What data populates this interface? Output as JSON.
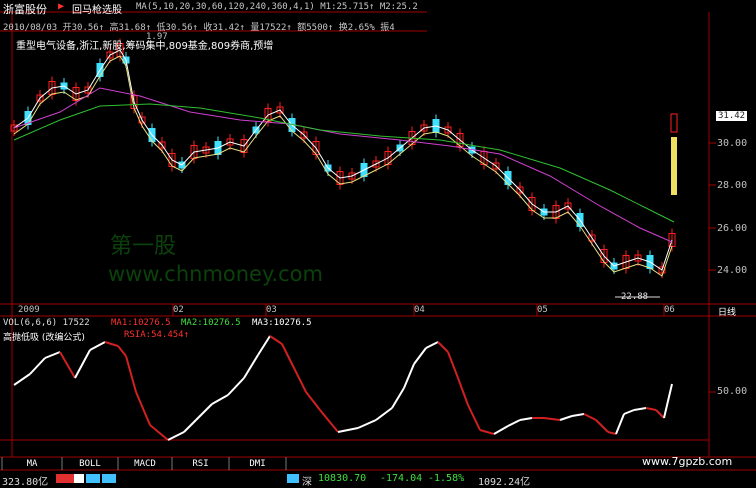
{
  "header": {
    "stock_name": "浙富股份",
    "arrow": "▶",
    "formula_name": "回马枪选股",
    "ma_line": "MA(5,10,20,30,60,120,240,360,4,1) M1:25.715↑ M2:25.2",
    "date_line": "2010/08/03 开30.56↑ 高31.68↑ 低30.56↑ 收31.42↑ 量17522↑ 额5500↑ 换2.65% 振4",
    "info_line": "重型电气设备,浙江,新股,筹码集中,809基金,809券商,预增",
    "small_label": "1.97"
  },
  "price_axis": {
    "ticks": [
      "31.42",
      "30.00",
      "28.00",
      "26.00",
      "24.00"
    ],
    "low_label": "22.88"
  },
  "time_axis": {
    "labels": [
      "2009",
      "02",
      "03",
      "04",
      "05",
      "06"
    ],
    "period": "日线"
  },
  "volume_header": {
    "vol": "VOL(6,6,6) 17522",
    "ma1": "MA1:10276.5",
    "ma2": "MA2:10276.5",
    "ma3": "MA3:10276.5"
  },
  "indicator": {
    "title": "高抛低吸 (改编公式)",
    "value": "RSIA:54.454↑",
    "tick": "50.00"
  },
  "tabs": [
    "MA",
    "BOLL",
    "MACD",
    "RSI",
    "DMI"
  ],
  "status_bar": {
    "left": "323.80亿",
    "shenzhen": "深",
    "index": "10830.70",
    "change": "-174.04",
    "pct": "-1.58%",
    "amount": "1092.24亿"
  },
  "watermark": {
    "cn": "第一股",
    "url": "www.chnmoney.com",
    "site": "www.7gpzb.com"
  },
  "colors": {
    "up": "#ff2020",
    "down": "#40e0ff",
    "ma_white": "#ffffff",
    "ma_yellow": "#e8e080",
    "ma_magenta": "#d040d0",
    "ma_green": "#30c030",
    "grid": "#a00000"
  }
}
